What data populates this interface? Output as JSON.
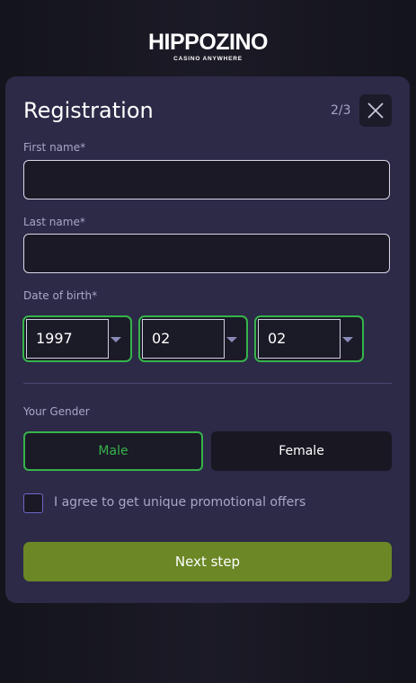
{
  "logo": {
    "name": "HIPPOZINO",
    "tagline": "CASINO ANYWHERE"
  },
  "form": {
    "title": "Registration",
    "step": "2/3",
    "first_name": {
      "label": "First name*",
      "value": ""
    },
    "last_name": {
      "label": "Last name*",
      "value": ""
    },
    "dob": {
      "label": "Date of birth*",
      "year": "1997",
      "month": "02",
      "day": "02"
    },
    "gender": {
      "label": "Your Gender",
      "options": [
        "Male",
        "Female"
      ],
      "selected": "Male"
    },
    "promo": {
      "label": "I agree to get unique promotional offers",
      "checked": false
    },
    "next_label": "Next step"
  },
  "colors": {
    "card_bg": "#2c2a47",
    "accent_green": "#36b34b",
    "next_button": "#6b8726",
    "checkbox_border": "#6d68c8"
  }
}
